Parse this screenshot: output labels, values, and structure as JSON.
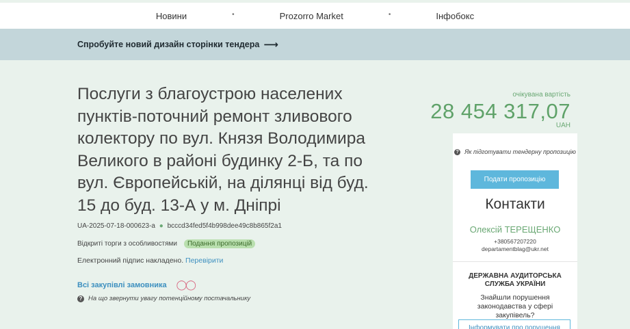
{
  "nav": {
    "items": [
      "Новини",
      "Prozorro Market",
      "Інфобокс"
    ]
  },
  "banner": {
    "text": "Спробуйте новий дизайн сторінки тендера",
    "arrow": "⟶"
  },
  "tender": {
    "title": "Послуги з благоустрою населених пунктів-поточний ремонт зливового колектору по вул. Князя Володимира Великого в районі будинку 2-Б, та по вул. Європейській, на ділянці від буд. 15 до буд. 13-А у м. Дніпрі",
    "id": "UA-2025-07-18-000623-a",
    "hash": "bcccd34fed5f4b998dee49c8b865f2a1",
    "procedure": "Відкриті торги з особливостями",
    "status": "Подання пропозицій",
    "signature_text": "Електронний підпис накладено.",
    "signature_link": "Перевірити",
    "buyer_link": "Всі закупівлі замовника",
    "hint": "На що звернути увагу потенційному постачальнику"
  },
  "budget": {
    "label": "очікувана вартість",
    "amount": "28 454 317,07",
    "currency": "UAH"
  },
  "panel": {
    "howto": "Як підготувати тендерну пропозицію",
    "submit_button": "Подати пропозицію",
    "contacts_title": "Контакти",
    "contact_name": "Олексій ТЕРЕЩЕНКО",
    "contact_phone": "+380567207220",
    "contact_email": "departamentblag@ukr.net",
    "audit_title": "ДЕРЖАВНА АУДИТОРСЬКА СЛУЖБА УКРАЇНИ",
    "audit_question": "Знайшли порушення законодавства у сфері закупівель?",
    "report_button": "Інформувати про порушення"
  },
  "colors": {
    "page_bg": "#e9f2ec",
    "banner_bg": "#c3d6da",
    "accent_green": "#5fa269",
    "accent_blue": "#5eb7dc",
    "link_blue": "#3c8fbf",
    "status_bg": "#b9dfae"
  }
}
